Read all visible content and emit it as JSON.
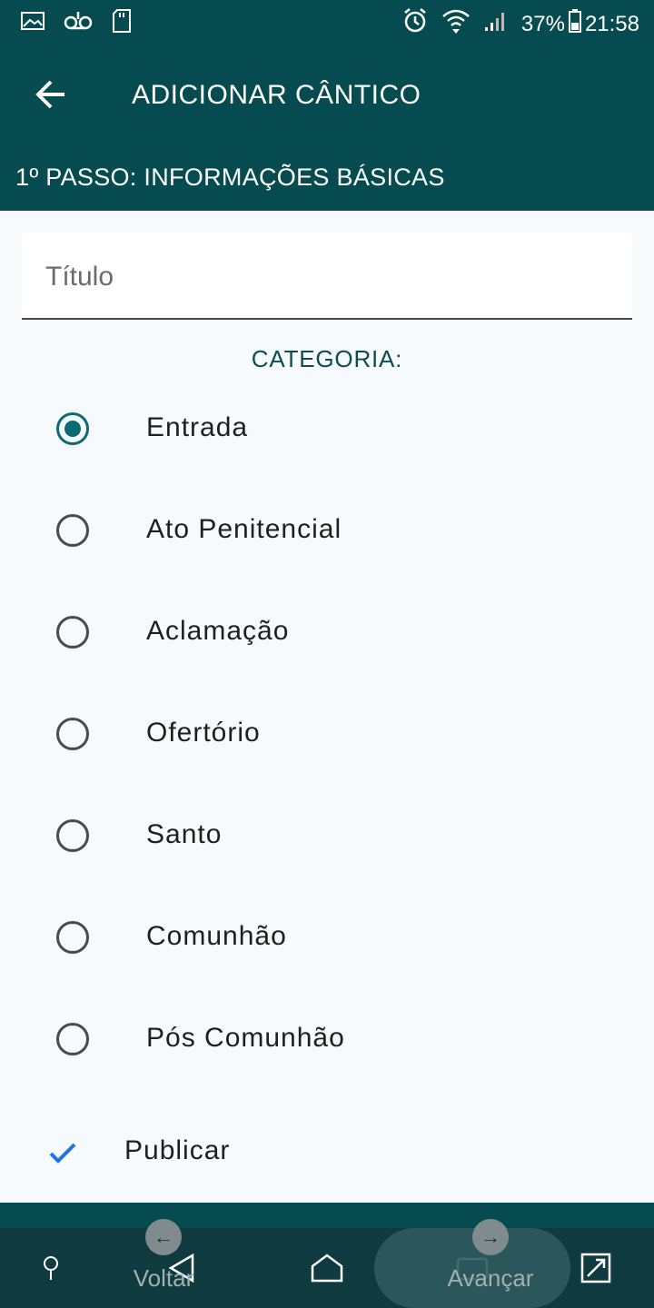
{
  "status_bar": {
    "battery_percent": "37%",
    "time": "21:58"
  },
  "app_bar": {
    "title": "ADICIONAR CÂNTICO",
    "step": "1º PASSO: INFORMAÇÕES BÁSICAS"
  },
  "form": {
    "title_placeholder": "Título",
    "title_value": "",
    "category_label": "CATEGORIA:",
    "categories": [
      {
        "label": "Entrada",
        "selected": true
      },
      {
        "label": "Ato Penitencial",
        "selected": false
      },
      {
        "label": "Aclamação",
        "selected": false
      },
      {
        "label": "Ofertório",
        "selected": false
      },
      {
        "label": "Santo",
        "selected": false
      },
      {
        "label": "Comunhão",
        "selected": false
      },
      {
        "label": "Pós Comunhão",
        "selected": false
      }
    ],
    "publish_label": "Publicar",
    "publish_checked": true
  },
  "bottom_actions": {
    "back_label": "Voltar",
    "next_label": "Avançar"
  },
  "colors": {
    "primary": "#064b50",
    "accent": "#0d6b72",
    "check": "#1a73e8"
  }
}
